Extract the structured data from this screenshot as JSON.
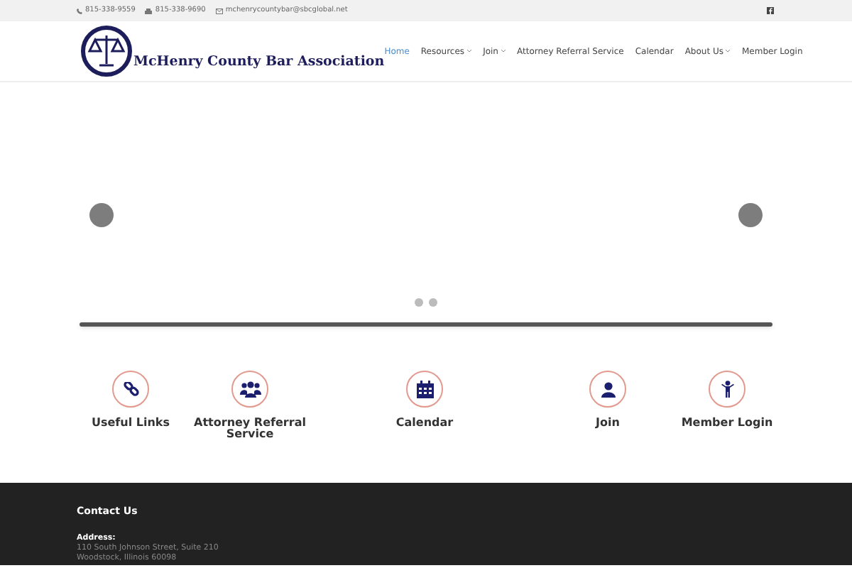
{
  "top_bar": {
    "phone": "815-338-9559",
    "fax": "815-338-9690",
    "email": "mchenrycountybar@sbcglobal.net"
  },
  "header": {
    "logo_text": "McHenry County Bar Association",
    "nav": [
      {
        "label": "Home",
        "selected": true,
        "has_menu": false
      },
      {
        "label": "Resources",
        "selected": false,
        "has_menu": true
      },
      {
        "label": "Join",
        "selected": false,
        "has_menu": true
      },
      {
        "label": "Attorney Referral Service",
        "selected": false,
        "has_menu": false
      },
      {
        "label": "Calendar",
        "selected": false,
        "has_menu": false
      },
      {
        "label": "About Us",
        "selected": false,
        "has_menu": true
      },
      {
        "label": "Member Login",
        "selected": false,
        "has_menu": false
      }
    ]
  },
  "slider": {
    "dots": [
      {
        "selected": false
      },
      {
        "selected": false
      }
    ]
  },
  "quick_links": [
    {
      "kind": "link",
      "label": "Useful Links"
    },
    {
      "kind": "group",
      "label": "Attorney Referral Service"
    },
    {
      "kind": "calendar",
      "label": "Calendar"
    },
    {
      "kind": "user",
      "label": "Join"
    },
    {
      "kind": "person",
      "label": "Member Login"
    }
  ],
  "footer": {
    "heading": "Contact Us",
    "address_label": "Address:",
    "address_lines": [
      "110 South Johnson Street, Suite 210",
      "Woodstock, Illinois 60098"
    ]
  }
}
